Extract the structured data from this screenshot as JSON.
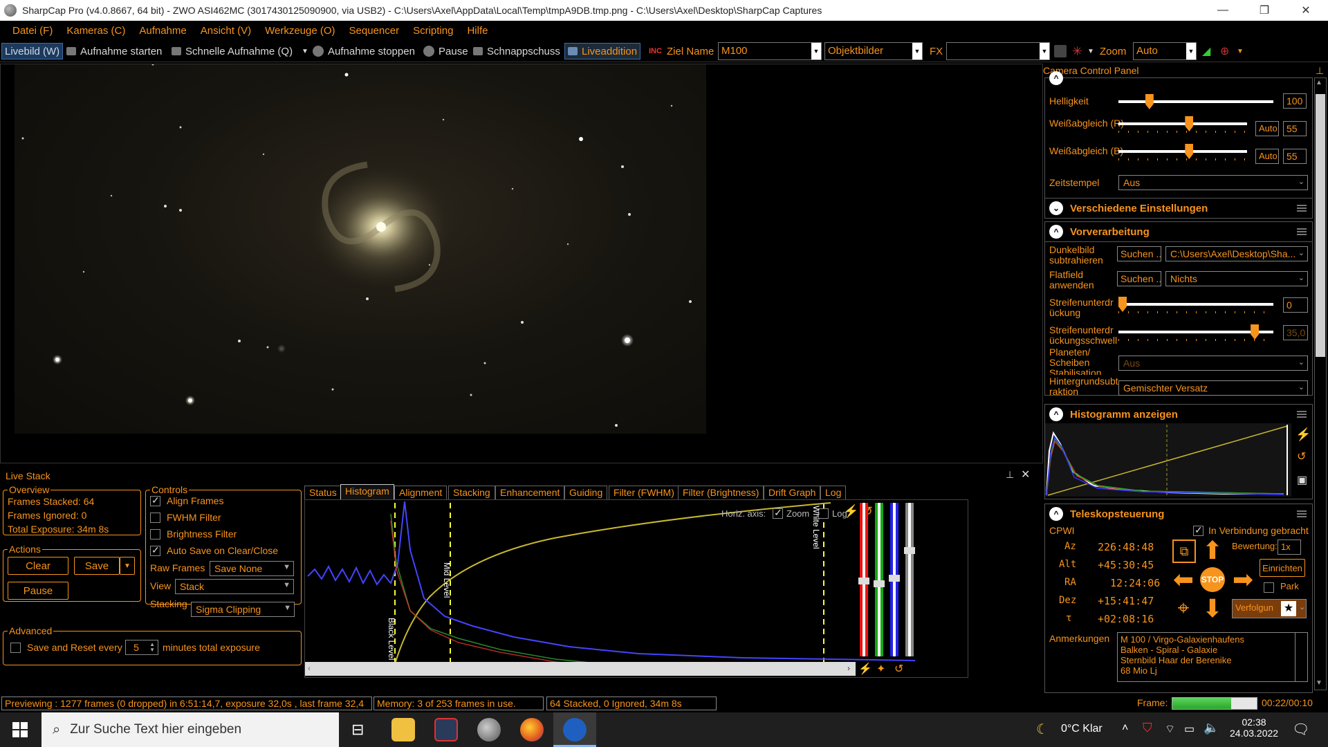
{
  "window": {
    "title": "SharpCap Pro (v4.0.8667, 64 bit) - ZWO ASI462MC (3017430125090900, via USB2) - C:\\Users\\Axel\\AppData\\Local\\Temp\\tmpA9DB.tmp.png - C:\\Users\\Axel\\Desktop\\SharpCap Captures",
    "minimize": "—",
    "restore": "❐",
    "close": "✕"
  },
  "menu": [
    "Datei (F)",
    "Kameras (C)",
    "Aufnahme",
    "Ansicht (V)",
    "Werkzeuge (O)",
    "Sequencer",
    "Scripting",
    "Hilfe"
  ],
  "toolbar": {
    "livebild": "Livebild (W)",
    "aufnahme_starten": "Aufnahme starten",
    "schnelle_aufnahme": "Schnelle Aufnahme (Q)",
    "aufnahme_stoppen": "Aufnahme stoppen",
    "pause": "Pause",
    "schnappschuss": "Schnappschuss",
    "liveaddition": "Liveaddition",
    "ziel_name_label": "Ziel Name",
    "ziel_name_value": "M100",
    "objektbilder": "Objektbilder",
    "fx_label": "FX",
    "fx_value": "",
    "zoom_label": "Zoom",
    "zoom_value": "Auto"
  },
  "livestack": {
    "title": "Live Stack",
    "overview": {
      "label": "Overview",
      "frames_stacked": "Frames Stacked: 64",
      "frames_ignored": "Frames Ignored:  0",
      "total_exposure": "Total Exposure:   34m 8s"
    },
    "actions": {
      "label": "Actions",
      "clear": "Clear",
      "save": "Save",
      "pause": "Pause"
    },
    "controls": {
      "label": "Controls",
      "align_frames": "Align Frames",
      "fwhm_filter": "FWHM Filter",
      "brightness_filter": "Brightness Filter",
      "auto_save": "Auto Save on Clear/Close",
      "raw_frames_label": "Raw Frames",
      "raw_frames_value": "Save None",
      "view_label": "View",
      "view_value": "Stack",
      "stacking_label": "Stacking",
      "stacking_value": "Sigma Clipping"
    },
    "advanced": {
      "label": "Advanced",
      "save_reset": "Save and Reset every",
      "minutes_value": "5",
      "minutes_suffix": "minutes total exposure"
    },
    "tabs": [
      "Status",
      "Histogram",
      "Alignment",
      "Stacking",
      "Enhancement",
      "Guiding",
      "Filter (FWHM)",
      "Filter (Brightness)",
      "Drift Graph",
      "Log"
    ],
    "active_tab": "Histogram",
    "histogram": {
      "horiz_axis": "Horiz. axis:",
      "zoom": "Zoom",
      "log": "Log",
      "black_level": "Black Level",
      "mid_level": "Mid Level",
      "white_level": "White Level"
    }
  },
  "status": {
    "previewing": "Previewing : 1277 frames (0 dropped) in 6:51:14,7, exposure 32,0s , last frame 32,4",
    "memory": "Memory: 3 of 253 frames in use.",
    "stacked": "64 Stacked, 0 Ignored, 34m 8s",
    "frame_label": "Frame:",
    "frame_progress": 0.7,
    "frame_time": "00:22/00:10"
  },
  "panel": {
    "title": "Camera Control Panel",
    "helligkeit_label": "Helligkeit",
    "helligkeit_value": "100",
    "helligkeit_level": 0.2,
    "wb_r_label": "Weißabgleich (R)",
    "wb_r_auto": "Auto",
    "wb_r_value": "55",
    "wb_r_level": 0.55,
    "wb_b_label": "Weißabgleich (B)",
    "wb_b_auto": "Auto",
    "wb_b_value": "55",
    "wb_b_level": 0.55,
    "zeitstempel_label": "Zeitstempel",
    "zeitstempel_value": "Aus",
    "verschiedene": "Verschiedene Einstellungen",
    "vorverarbeitung": "Vorverarbeitung",
    "dunkelbild_label": "Dunkelbild subtrahieren",
    "dunkelbild_btn": "Suchen ...",
    "dunkelbild_value": "C:\\Users\\Axel\\Desktop\\Sha...",
    "flatfield_label": "Flatfield anwenden",
    "flatfield_btn": "Suchen ...",
    "flatfield_value": "Nichts",
    "streifen_label": "Streifenunterdrückung",
    "streifen_value": "0",
    "streifen_level": 0.0,
    "schwelle_label": "Streifenunterdrückungsschwelle",
    "schwelle_value": "35,0",
    "schwelle_level": 0.88,
    "planeten_label": "Planeten/ Scheiben Stabilisation",
    "planeten_value": "Aus",
    "hintergrund_label": "Hintergrundsubtraktion",
    "hintergrund_value": "Gemischter Versatz",
    "histogramm": "Histogramm anzeigen",
    "teleskop": "Teleskopsteuerung",
    "cpwi": "CPWI",
    "verbunden": "In Verbindung gebracht",
    "bewertung_label": "Bewertung:",
    "bewertung_value": "1x",
    "az_label": "Az",
    "az_value": "226:48:48",
    "alt_label": "Alt",
    "alt_value": "+45:30:45",
    "ra_label": "RA",
    "ra_value": "12:24:06",
    "dez_label": "Dez",
    "dez_value": "+15:41:47",
    "tau_label": "τ",
    "tau_value": "+02:08:16",
    "stop": "STOP",
    "einrichten": "Einrichten",
    "park": "Park",
    "verfolgung": "Verfolgun",
    "anmerkungen_label": "Anmerkungen",
    "anmerkungen": [
      "M 100 /  Virgo-Galaxienhaufens",
      "Balken - Spiral - Galaxie",
      "Sternbild Haar der Berenike",
      "68 Mio Lj"
    ]
  },
  "taskbar": {
    "search_placeholder": "Zur Suche Text hier eingeben",
    "weather": "0°C  Klar",
    "time": "02:38",
    "date": "24.03.2022"
  },
  "colors": {
    "accent": "#f7941d",
    "background": "#000000",
    "taskbar": "#1f1f1f"
  }
}
